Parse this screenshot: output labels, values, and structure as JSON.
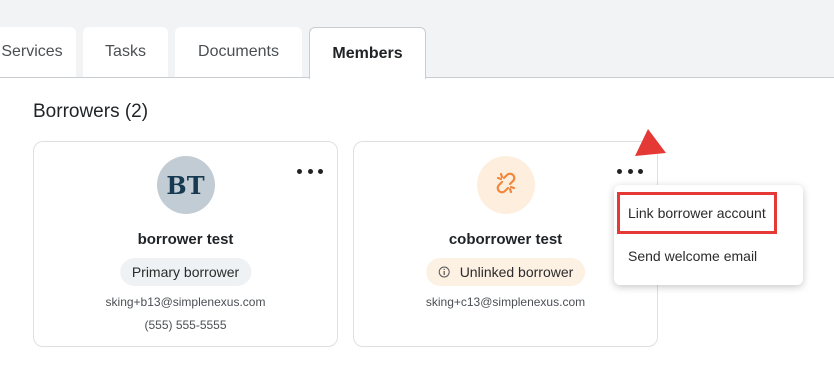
{
  "tabs": [
    {
      "label": "Services",
      "active": false
    },
    {
      "label": "Tasks",
      "active": false
    },
    {
      "label": "Documents",
      "active": false
    },
    {
      "label": "Members",
      "active": true
    }
  ],
  "section": {
    "title": "Borrowers (2)"
  },
  "borrowers": [
    {
      "initials": "BT",
      "name": "borrower test",
      "badge": "Primary borrower",
      "email": "sking+b13@simplenexus.com",
      "phone": "(555) 555-5555"
    },
    {
      "icon": "unlinked-chain-icon",
      "name": "coborrower test",
      "badge": "Unlinked borrower",
      "badge_icon": "info-icon",
      "email": "sking+c13@simplenexus.com"
    }
  ],
  "menu": {
    "items": [
      {
        "label": "Link borrower account",
        "highlighted": true
      },
      {
        "label": "Send welcome email"
      }
    ]
  },
  "colors": {
    "annotation_red": "#e53935",
    "unlinked_orange": "#f0883e",
    "avatar_navy": "#173a52",
    "avatar_bg": "#c2ccd4"
  }
}
